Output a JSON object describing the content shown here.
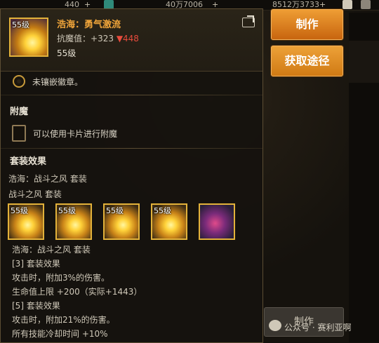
{
  "topbar": {
    "value1": "440",
    "value2": "40万7006",
    "value3": "8512万3733",
    "plus": "+"
  },
  "item": {
    "level_tag": "55级",
    "name": "浩海：勇气激流",
    "enchant_label": "抗魔值：",
    "enchant_up": "+323",
    "enchant_down": "▼448",
    "level": "55级"
  },
  "emblem": {
    "text": "未镶嵌徽章。"
  },
  "enchant_section": {
    "title": "附魔",
    "hint": "可以使用卡片进行附魔"
  },
  "set_section": {
    "title": "套装效果",
    "line1": "浩海：战斗之风 套装",
    "line2": "战斗之风 套装",
    "icons": [
      {
        "label": "55级",
        "type": "weapon"
      },
      {
        "label": "55级",
        "type": "weapon"
      },
      {
        "label": "55级",
        "type": "weapon"
      },
      {
        "label": "55级",
        "type": "weapon"
      },
      {
        "label": "",
        "type": "special"
      }
    ],
    "desc": [
      "浩海：战斗之风 套装",
      "[3] 套装效果",
      "攻击时，附加3%的伤害。",
      "生命值上限 +200（实际+1443）",
      "[5] 套装效果",
      "攻击时，附加21%的伤害。",
      "所有技能冷却时间 +10%"
    ]
  },
  "buttons": {
    "craft": "制作",
    "source": "获取途径",
    "bottom_craft": "制作"
  },
  "watermark": "公众号 · 赛利亚啊"
}
